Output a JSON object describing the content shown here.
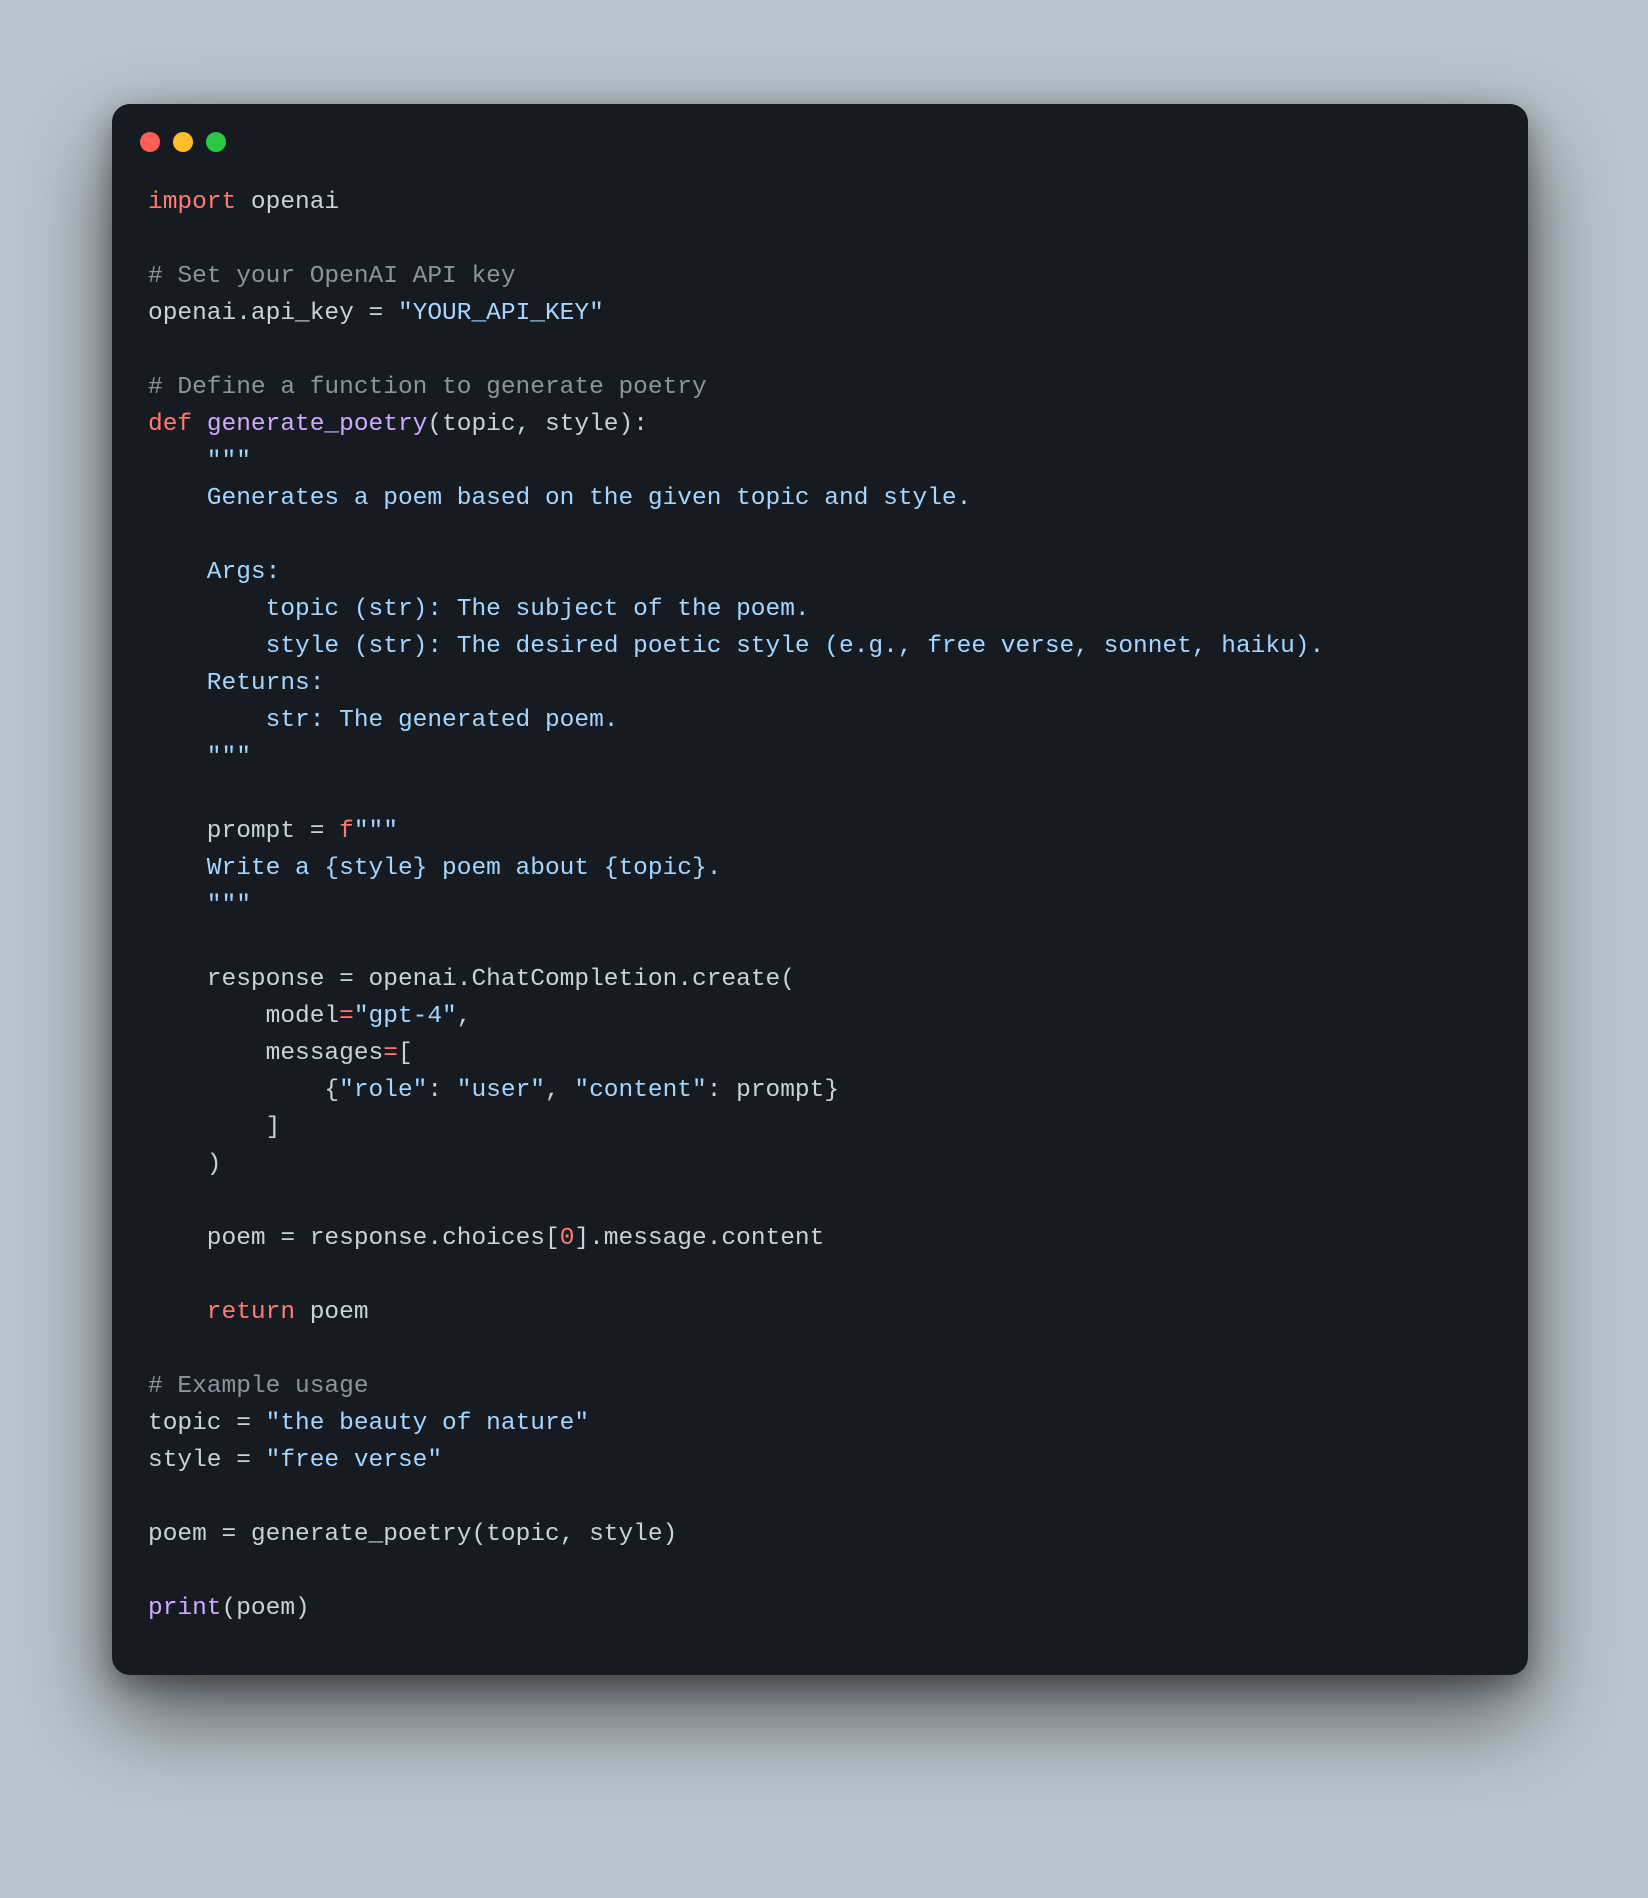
{
  "window": {
    "traffic_lights": [
      "close",
      "minimize",
      "zoom"
    ]
  },
  "code": {
    "line1_import": "import",
    "line1_mod": "openai",
    "c_set_key": "# Set your OpenAI API key",
    "l_openai": "openai",
    "l_dot": ".",
    "l_api_key_attr": "api_key",
    "l_eq": " = ",
    "l_api_key_val": "\"YOUR_API_KEY\"",
    "c_def_fn": "# Define a function to generate poetry",
    "kw_def": "def",
    "fn_name": "generate_poetry",
    "args_open": "(",
    "arg_topic": "topic",
    "comma": ", ",
    "arg_style": "style",
    "args_close_colon": "):",
    "doc_open": "    \"\"\"",
    "doc_l1": "    Generates a poem based on the given topic and style.",
    "doc_blank": "",
    "doc_args": "    Args:",
    "doc_arg1": "        topic (str): The subject of the poem.",
    "doc_arg2": "        style (str): The desired poetic style (e.g., free verse, sonnet, haiku).",
    "doc_ret": "    Returns:",
    "doc_ret1": "        str: The generated poem.",
    "doc_close": "    \"\"\"",
    "prompt_assign_name": "    prompt",
    "prompt_eq": " = ",
    "prompt_f": "f",
    "prompt_open": "\"\"\"",
    "prompt_body": "    Write a {style} poem about {topic}.",
    "prompt_close": "    \"\"\"",
    "resp_name": "    response",
    "resp_eq": " = ",
    "resp_openai": "openai",
    "resp_chat": "ChatCompletion",
    "resp_create": "create",
    "resp_open": "(",
    "model_kw": "        model",
    "model_eq": "=",
    "model_val": "\"gpt-4\"",
    "model_comma": ",",
    "msgs_kw": "        messages",
    "msgs_eq": "=",
    "msgs_open": "[",
    "msg_dict_open": "            {",
    "msg_role_k": "\"role\"",
    "msg_colon": ": ",
    "msg_role_v": "\"user\"",
    "msg_sep": ", ",
    "msg_content_k": "\"content\"",
    "msg_content_v": "prompt",
    "msg_dict_close": "}",
    "msgs_close": "        ]",
    "resp_close": "    )",
    "poem_assign": "    poem",
    "poem_eq": " = ",
    "poem_response": "response",
    "poem_choices": "choices",
    "poem_idx_open": "[",
    "poem_idx": "0",
    "poem_idx_close": "]",
    "poem_message": "message",
    "poem_content": "content",
    "kw_return": "    return",
    "ret_val": " poem",
    "c_example": "# Example usage",
    "ex_topic_name": "topic",
    "ex_topic_eq": " = ",
    "ex_topic_val": "\"the beauty of nature\"",
    "ex_style_name": "style",
    "ex_style_eq": " = ",
    "ex_style_val": "\"free verse\"",
    "ex_poem_name": "poem",
    "ex_poem_eq": " = ",
    "ex_call_name": "generate_poetry",
    "ex_call_open": "(",
    "ex_call_a1": "topic",
    "ex_call_sep": ", ",
    "ex_call_a2": "style",
    "ex_call_close": ")",
    "print_name": "print",
    "print_open": "(",
    "print_arg": "poem",
    "print_close": ")"
  }
}
